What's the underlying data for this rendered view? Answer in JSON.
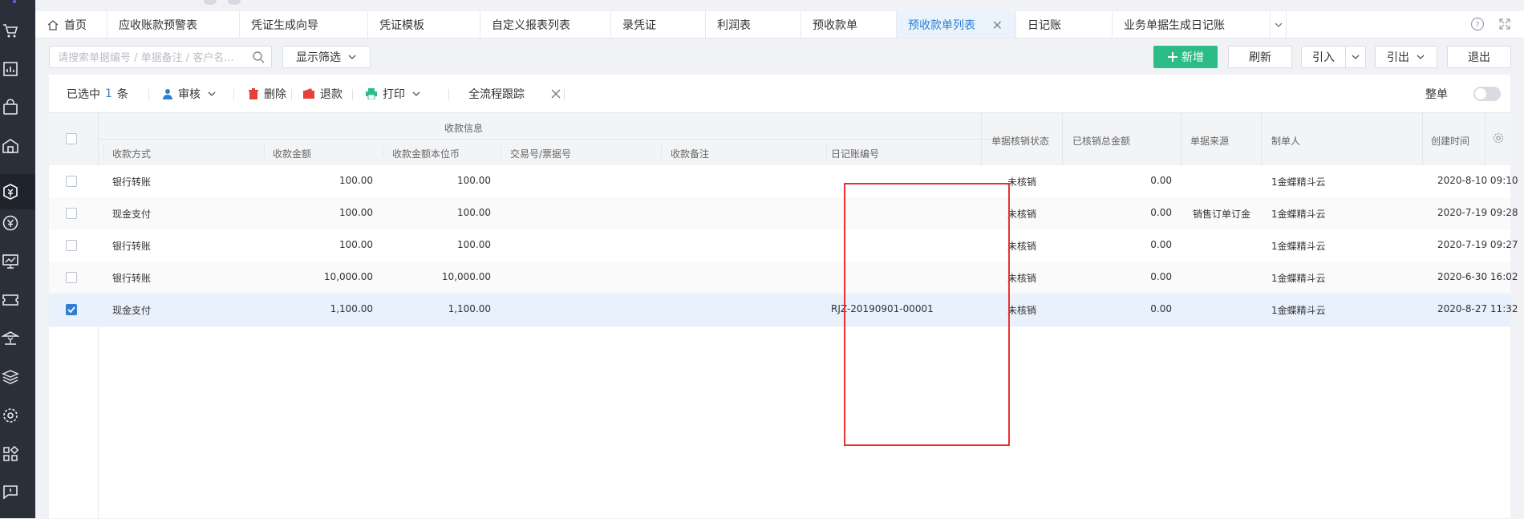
{
  "tabs": [
    {
      "label": "首页",
      "icon": "home-icon"
    },
    {
      "label": "应收账款预警表"
    },
    {
      "label": "凭证生成向导"
    },
    {
      "label": "凭证模板"
    },
    {
      "label": "自定义报表列表"
    },
    {
      "label": "录凭证"
    },
    {
      "label": "利润表"
    },
    {
      "label": "预收款单"
    },
    {
      "label": "预收款单列表",
      "active": true
    },
    {
      "label": "日记账"
    },
    {
      "label": "业务单据生成日记账"
    }
  ],
  "search": {
    "placeholder": "请搜索单据编号 / 单据备注 / 客户名..."
  },
  "toolbar": {
    "filter_label": "显示筛选",
    "new_label": "新增",
    "refresh_label": "刷新",
    "import_label": "引入",
    "export_label": "引出",
    "exit_label": "退出"
  },
  "actions": {
    "selected_prefix": "已选中",
    "selected_count": "1",
    "selected_suffix": "条",
    "audit_label": "审核",
    "delete_label": "删除",
    "refund_label": "退款",
    "print_label": "打印",
    "trace_label": "全流程跟踪",
    "whole_label": "整单"
  },
  "table": {
    "group_header": "收款信息",
    "columns": {
      "method": "收款方式",
      "amount": "收款金额",
      "amount_base": "收款金额本位币",
      "trade_no": "交易号/票据号",
      "remark": "收款备注",
      "journal_no": "日记账编号",
      "writeoff_status": "单据核销状态",
      "writeoff_total": "已核销总金额",
      "source": "单据来源",
      "creator": "制单人",
      "created_at": "创建时间"
    },
    "rows": [
      {
        "method": "银行转账",
        "amount": "100.00",
        "amount_base": "100.00",
        "trade_no": "",
        "remark": "",
        "journal_no": "",
        "writeoff_status": "未核销",
        "writeoff_total": "0.00",
        "source": "",
        "creator": "1金蝶精斗云",
        "created_at": "2020-8-10 09:10",
        "checked": false
      },
      {
        "method": "现金支付",
        "amount": "100.00",
        "amount_base": "100.00",
        "trade_no": "",
        "remark": "",
        "journal_no": "",
        "writeoff_status": "未核销",
        "writeoff_total": "0.00",
        "source": "销售订单订金",
        "creator": "1金蝶精斗云",
        "created_at": "2020-7-19 09:28",
        "checked": false
      },
      {
        "method": "银行转账",
        "amount": "100.00",
        "amount_base": "100.00",
        "trade_no": "",
        "remark": "",
        "journal_no": "",
        "writeoff_status": "未核销",
        "writeoff_total": "0.00",
        "source": "",
        "creator": "1金蝶精斗云",
        "created_at": "2020-7-19 09:27",
        "checked": false
      },
      {
        "method": "银行转账",
        "amount": "10,000.00",
        "amount_base": "10,000.00",
        "trade_no": "",
        "remark": "",
        "journal_no": "",
        "writeoff_status": "未核销",
        "writeoff_total": "0.00",
        "source": "",
        "creator": "1金蝶精斗云",
        "created_at": "2020-6-30 16:02",
        "checked": false
      },
      {
        "method": "现金支付",
        "amount": "1,100.00",
        "amount_base": "1,100.00",
        "trade_no": "",
        "remark": "",
        "journal_no": "RJZ-20190901-00001",
        "writeoff_status": "未核销",
        "writeoff_total": "0.00",
        "source": "",
        "creator": "1金蝶精斗云",
        "created_at": "2020-8-27 11:32",
        "checked": true
      }
    ]
  },
  "colors": {
    "accent": "#2f7fd3",
    "primary_button": "#2dbb87",
    "highlight_box": "#e83232",
    "rail": "#2b2f3a"
  }
}
